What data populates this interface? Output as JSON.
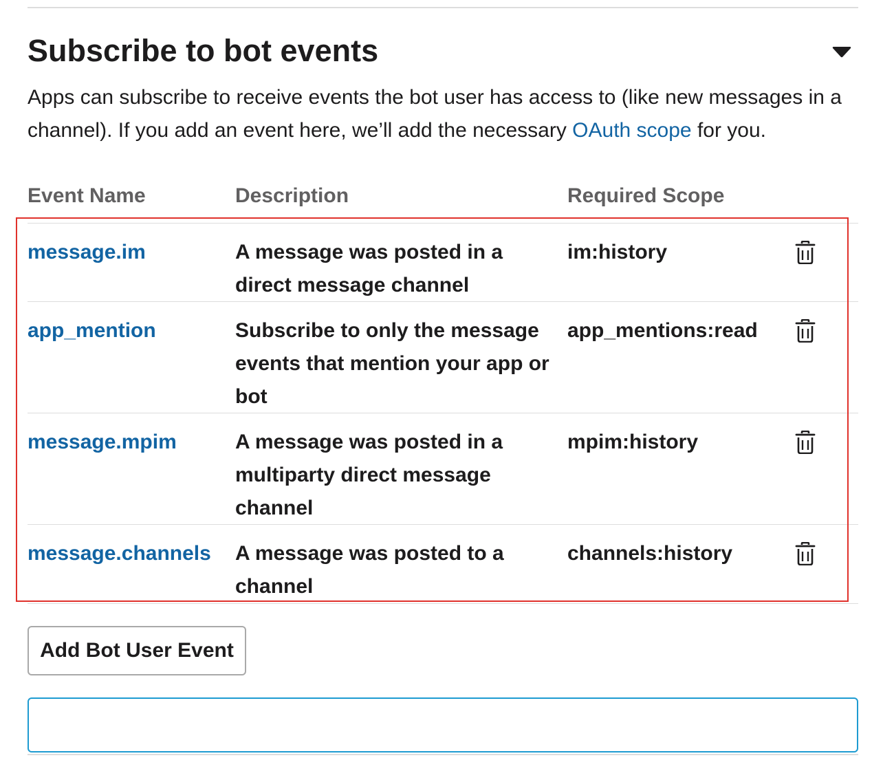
{
  "section": {
    "title": "Subscribe to bot events",
    "description_before": "Apps can subscribe to receive events the bot user has access to (like new messages in a channel). If you add an event here, we’ll add the necessary ",
    "description_link": "OAuth scope",
    "description_after": " for you.",
    "toggle_icon": "caret-down-icon"
  },
  "table": {
    "headers": {
      "event_name": "Event Name",
      "description": "Description",
      "required_scope": "Required Scope"
    },
    "rows": [
      {
        "name": "message.im",
        "description": "A message was posted in a direct message channel",
        "scope": "im:history"
      },
      {
        "name": "app_mention",
        "description": "Subscribe to only the message events that mention your app or bot",
        "scope": "app_mentions:read"
      },
      {
        "name": "message.mpim",
        "description": "A message was posted in a multiparty direct message channel",
        "scope": "mpim:history"
      },
      {
        "name": "message.channels",
        "description": "A message was posted to a channel",
        "scope": "channels:history"
      }
    ],
    "delete_icon": "trash-icon"
  },
  "actions": {
    "add_button_label": "Add Bot User Event",
    "input_value": ""
  },
  "colors": {
    "link": "#1264a3",
    "highlight_border": "#e0312b",
    "input_focus_border": "#1d9bd1",
    "muted_header": "#616061"
  }
}
